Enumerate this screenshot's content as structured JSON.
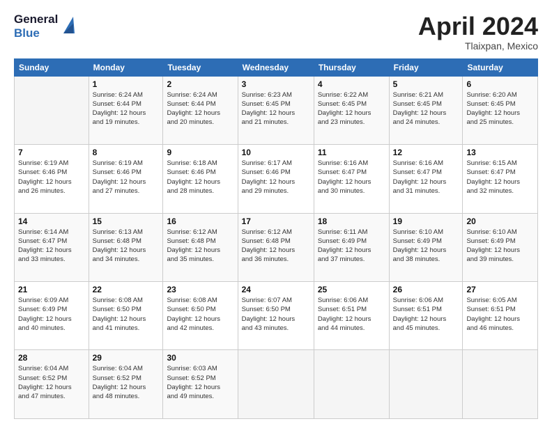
{
  "logo": {
    "line1": "General",
    "line2": "Blue"
  },
  "header": {
    "month": "April 2024",
    "location": "Tlaixpan, Mexico"
  },
  "weekdays": [
    "Sunday",
    "Monday",
    "Tuesday",
    "Wednesday",
    "Thursday",
    "Friday",
    "Saturday"
  ],
  "weeks": [
    [
      {
        "day": "",
        "info": ""
      },
      {
        "day": "1",
        "info": "Sunrise: 6:24 AM\nSunset: 6:44 PM\nDaylight: 12 hours\nand 19 minutes."
      },
      {
        "day": "2",
        "info": "Sunrise: 6:24 AM\nSunset: 6:44 PM\nDaylight: 12 hours\nand 20 minutes."
      },
      {
        "day": "3",
        "info": "Sunrise: 6:23 AM\nSunset: 6:45 PM\nDaylight: 12 hours\nand 21 minutes."
      },
      {
        "day": "4",
        "info": "Sunrise: 6:22 AM\nSunset: 6:45 PM\nDaylight: 12 hours\nand 23 minutes."
      },
      {
        "day": "5",
        "info": "Sunrise: 6:21 AM\nSunset: 6:45 PM\nDaylight: 12 hours\nand 24 minutes."
      },
      {
        "day": "6",
        "info": "Sunrise: 6:20 AM\nSunset: 6:45 PM\nDaylight: 12 hours\nand 25 minutes."
      }
    ],
    [
      {
        "day": "7",
        "info": "Sunrise: 6:19 AM\nSunset: 6:46 PM\nDaylight: 12 hours\nand 26 minutes."
      },
      {
        "day": "8",
        "info": "Sunrise: 6:19 AM\nSunset: 6:46 PM\nDaylight: 12 hours\nand 27 minutes."
      },
      {
        "day": "9",
        "info": "Sunrise: 6:18 AM\nSunset: 6:46 PM\nDaylight: 12 hours\nand 28 minutes."
      },
      {
        "day": "10",
        "info": "Sunrise: 6:17 AM\nSunset: 6:46 PM\nDaylight: 12 hours\nand 29 minutes."
      },
      {
        "day": "11",
        "info": "Sunrise: 6:16 AM\nSunset: 6:47 PM\nDaylight: 12 hours\nand 30 minutes."
      },
      {
        "day": "12",
        "info": "Sunrise: 6:16 AM\nSunset: 6:47 PM\nDaylight: 12 hours\nand 31 minutes."
      },
      {
        "day": "13",
        "info": "Sunrise: 6:15 AM\nSunset: 6:47 PM\nDaylight: 12 hours\nand 32 minutes."
      }
    ],
    [
      {
        "day": "14",
        "info": "Sunrise: 6:14 AM\nSunset: 6:47 PM\nDaylight: 12 hours\nand 33 minutes."
      },
      {
        "day": "15",
        "info": "Sunrise: 6:13 AM\nSunset: 6:48 PM\nDaylight: 12 hours\nand 34 minutes."
      },
      {
        "day": "16",
        "info": "Sunrise: 6:12 AM\nSunset: 6:48 PM\nDaylight: 12 hours\nand 35 minutes."
      },
      {
        "day": "17",
        "info": "Sunrise: 6:12 AM\nSunset: 6:48 PM\nDaylight: 12 hours\nand 36 minutes."
      },
      {
        "day": "18",
        "info": "Sunrise: 6:11 AM\nSunset: 6:49 PM\nDaylight: 12 hours\nand 37 minutes."
      },
      {
        "day": "19",
        "info": "Sunrise: 6:10 AM\nSunset: 6:49 PM\nDaylight: 12 hours\nand 38 minutes."
      },
      {
        "day": "20",
        "info": "Sunrise: 6:10 AM\nSunset: 6:49 PM\nDaylight: 12 hours\nand 39 minutes."
      }
    ],
    [
      {
        "day": "21",
        "info": "Sunrise: 6:09 AM\nSunset: 6:49 PM\nDaylight: 12 hours\nand 40 minutes."
      },
      {
        "day": "22",
        "info": "Sunrise: 6:08 AM\nSunset: 6:50 PM\nDaylight: 12 hours\nand 41 minutes."
      },
      {
        "day": "23",
        "info": "Sunrise: 6:08 AM\nSunset: 6:50 PM\nDaylight: 12 hours\nand 42 minutes."
      },
      {
        "day": "24",
        "info": "Sunrise: 6:07 AM\nSunset: 6:50 PM\nDaylight: 12 hours\nand 43 minutes."
      },
      {
        "day": "25",
        "info": "Sunrise: 6:06 AM\nSunset: 6:51 PM\nDaylight: 12 hours\nand 44 minutes."
      },
      {
        "day": "26",
        "info": "Sunrise: 6:06 AM\nSunset: 6:51 PM\nDaylight: 12 hours\nand 45 minutes."
      },
      {
        "day": "27",
        "info": "Sunrise: 6:05 AM\nSunset: 6:51 PM\nDaylight: 12 hours\nand 46 minutes."
      }
    ],
    [
      {
        "day": "28",
        "info": "Sunrise: 6:04 AM\nSunset: 6:52 PM\nDaylight: 12 hours\nand 47 minutes."
      },
      {
        "day": "29",
        "info": "Sunrise: 6:04 AM\nSunset: 6:52 PM\nDaylight: 12 hours\nand 48 minutes."
      },
      {
        "day": "30",
        "info": "Sunrise: 6:03 AM\nSunset: 6:52 PM\nDaylight: 12 hours\nand 49 minutes."
      },
      {
        "day": "",
        "info": ""
      },
      {
        "day": "",
        "info": ""
      },
      {
        "day": "",
        "info": ""
      },
      {
        "day": "",
        "info": ""
      }
    ]
  ]
}
